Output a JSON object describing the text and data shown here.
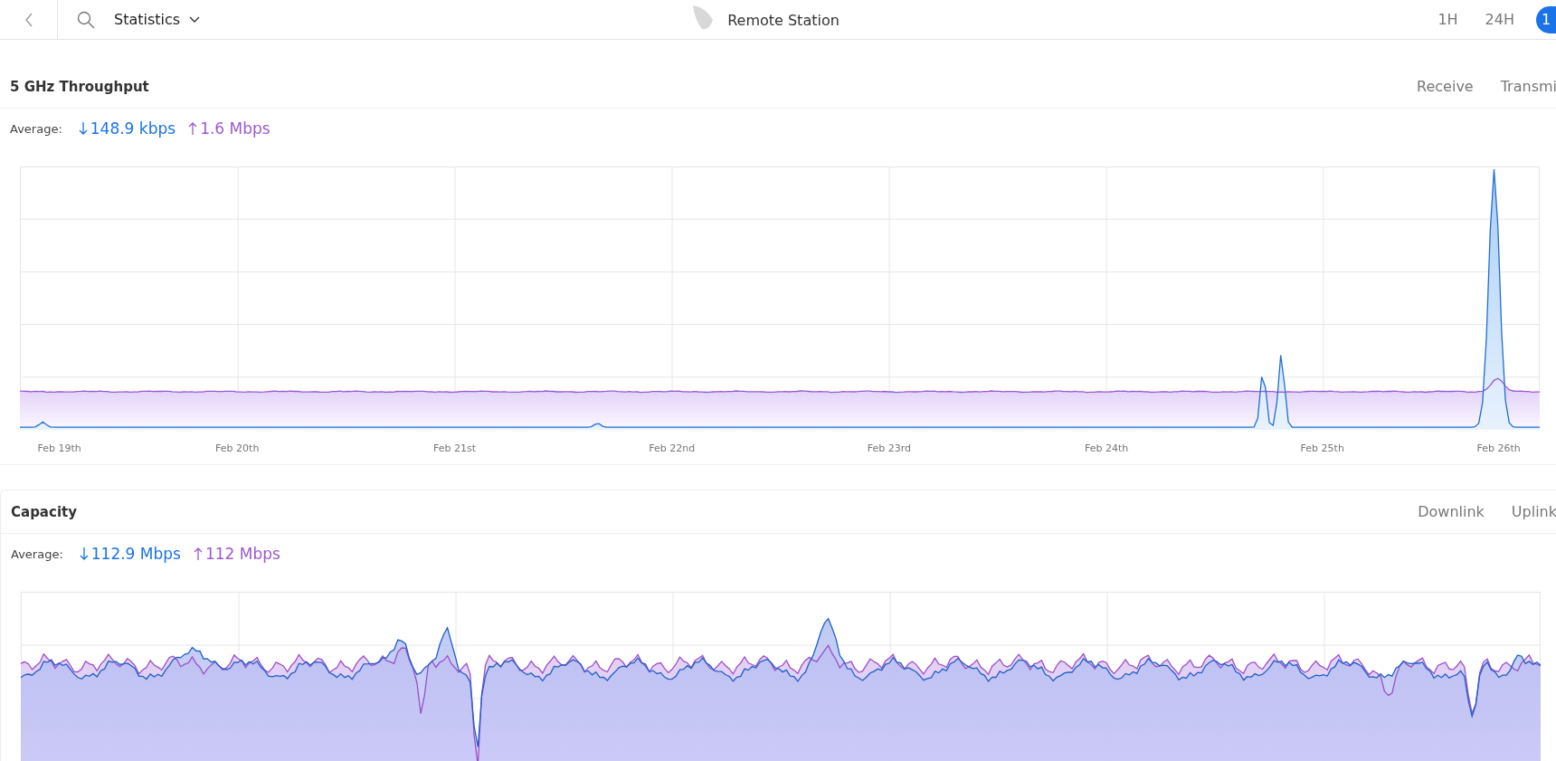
{
  "top_bar": {
    "title": "Statistics",
    "device": "Remote Station",
    "ranges": [
      {
        "label": "1H",
        "selected": false
      },
      {
        "label": "24H",
        "selected": false
      },
      {
        "label": "1",
        "selected": true
      }
    ]
  },
  "panels": [
    {
      "kind": "throughput",
      "title": "5 GHz Throughput",
      "tabs": [
        "Receive",
        "Transmi"
      ],
      "average_label": "Average:",
      "down": "148.9 kbps",
      "up": "1.6 Mbps",
      "x_labels": [
        "Feb 19th",
        "Feb 20th",
        "Feb 21st",
        "Feb 22nd",
        "Feb 23rd",
        "Feb 24th",
        "Feb 25th",
        "Feb 26th"
      ]
    },
    {
      "kind": "capacity",
      "title": "Capacity",
      "tabs": [
        "Downlink",
        "Uplink"
      ],
      "average_label": "Average:",
      "down": "112.9 Mbps",
      "up": "112 Mbps"
    }
  ]
}
